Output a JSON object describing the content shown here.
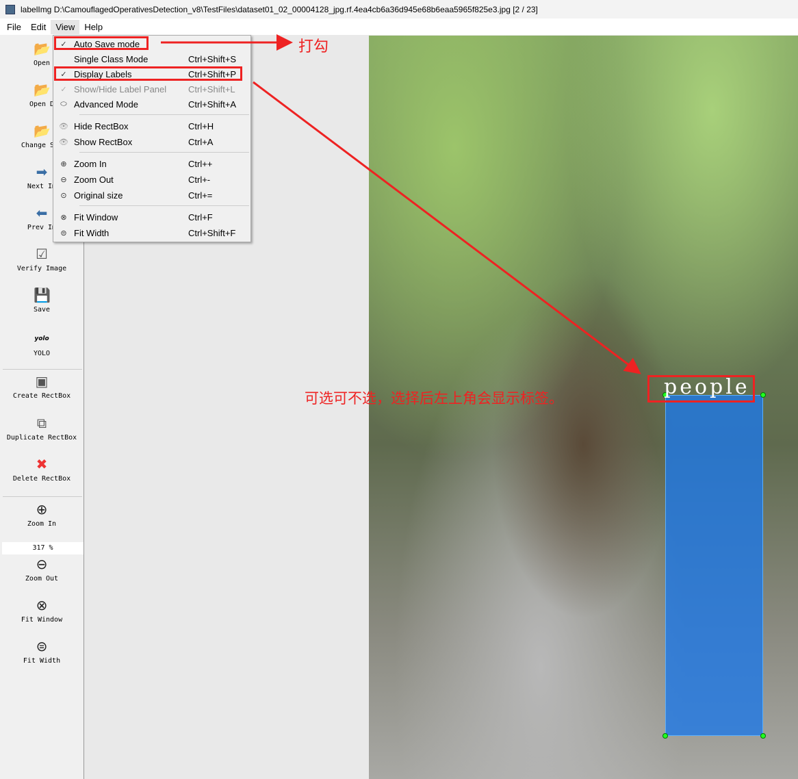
{
  "window": {
    "title": "labelImg D:\\CamouflagedOperativesDetection_v8\\TestFiles\\dataset01_02_00004128_jpg.rf.4ea4cb6a36d945e68b6eaa5965f825e3.jpg [2 / 23]"
  },
  "menubar": [
    "File",
    "Edit",
    "View",
    "Help"
  ],
  "toolbar": {
    "open": "Open",
    "open_dir": "Open D",
    "change_save": "Change Sav",
    "next": "Next Im",
    "prev": "Prev Im",
    "verify": "Verify Image",
    "save": "Save",
    "yolo_icon": "yolo",
    "yolo": "YOLO",
    "create": "Create RectBox",
    "duplicate": "Duplicate RectBox",
    "delete": "Delete RectBox",
    "zoom_in": "Zoom In",
    "zoom_value": "317 %",
    "zoom_out": "Zoom Out",
    "fit_window": "Fit Window",
    "fit_width": "Fit Width"
  },
  "view_menu": [
    {
      "label": "Auto Save mode",
      "shortcut": "",
      "checked": true
    },
    {
      "label": "Single Class Mode",
      "shortcut": "Ctrl+Shift+S"
    },
    {
      "label": "Display Labels",
      "shortcut": "Ctrl+Shift+P",
      "checked": true
    },
    {
      "label": "Show/Hide Label Panel",
      "shortcut": "Ctrl+Shift+L",
      "disabled": true
    },
    {
      "label": "Advanced Mode",
      "shortcut": "Ctrl+Shift+A"
    },
    {
      "label": "Hide RectBox",
      "shortcut": "Ctrl+H"
    },
    {
      "label": "Show RectBox",
      "shortcut": "Ctrl+A"
    },
    {
      "label": "Zoom In",
      "shortcut": "Ctrl++"
    },
    {
      "label": "Zoom Out",
      "shortcut": "Ctrl+-"
    },
    {
      "label": "Original size",
      "shortcut": "Ctrl+="
    },
    {
      "label": "Fit Window",
      "shortcut": "Ctrl+F"
    },
    {
      "label": "Fit Width",
      "shortcut": "Ctrl+Shift+F"
    }
  ],
  "canvas": {
    "box_label": "people"
  },
  "annotations": {
    "check_note": "打勾",
    "desc": "可选可不选，选择后左上角会显示标签。"
  },
  "colors": {
    "annotation": "#ee2222",
    "bbox": "#1e78e6"
  }
}
